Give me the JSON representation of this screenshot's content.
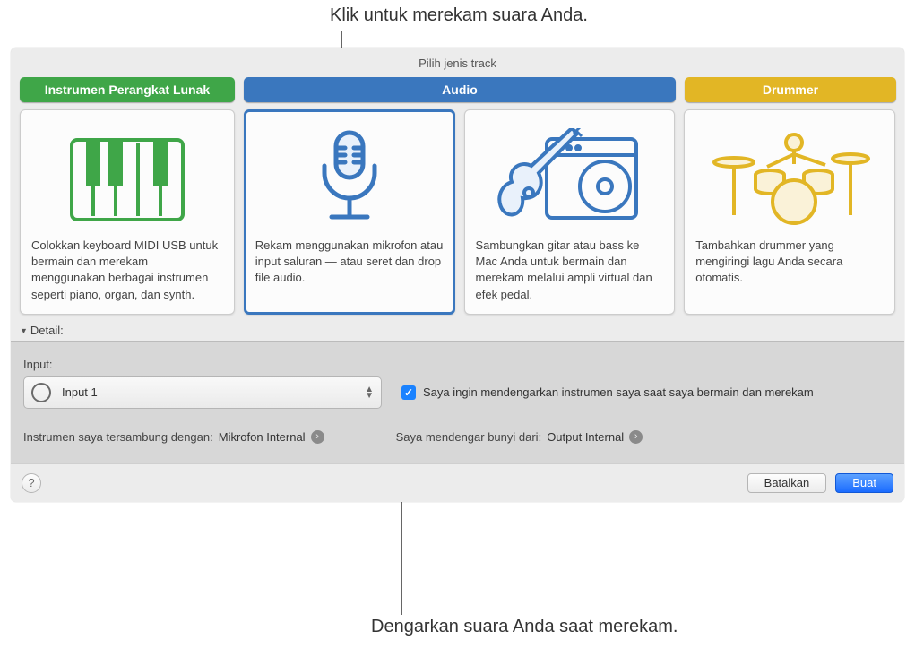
{
  "callouts": {
    "top": "Klik untuk merekam suara Anda.",
    "bottom": "Dengarkan suara Anda saat merekam."
  },
  "dialog": {
    "title": "Pilih jenis track",
    "tabs": {
      "software": "Instrumen Perangkat Lunak",
      "audio": "Audio",
      "drummer": "Drummer"
    },
    "cards": {
      "software": "Colokkan keyboard MIDI USB untuk bermain dan merekam menggunakan berbagai instrumen seperti piano, organ, dan synth.",
      "audio_mic": "Rekam menggunakan mikrofon atau input saluran — atau seret dan drop file audio.",
      "audio_guitar": "Sambungkan gitar atau bass ke Mac Anda untuk bermain dan merekam melalui ampli virtual dan efek pedal.",
      "drummer": "Tambahkan drummer yang mengiringi lagu Anda secara otomatis."
    },
    "details_label": "Detail:",
    "input_label": "Input:",
    "input_value": "Input 1",
    "monitor_checkbox": "Saya ingin mendengarkan instrumen saya saat saya bermain dan merekam",
    "connection": {
      "instrument_label": "Instrumen saya tersambung dengan:",
      "instrument_value": "Mikrofon Internal",
      "output_label": "Saya mendengar bunyi dari:",
      "output_value": "Output Internal"
    },
    "buttons": {
      "cancel": "Batalkan",
      "create": "Buat"
    }
  }
}
